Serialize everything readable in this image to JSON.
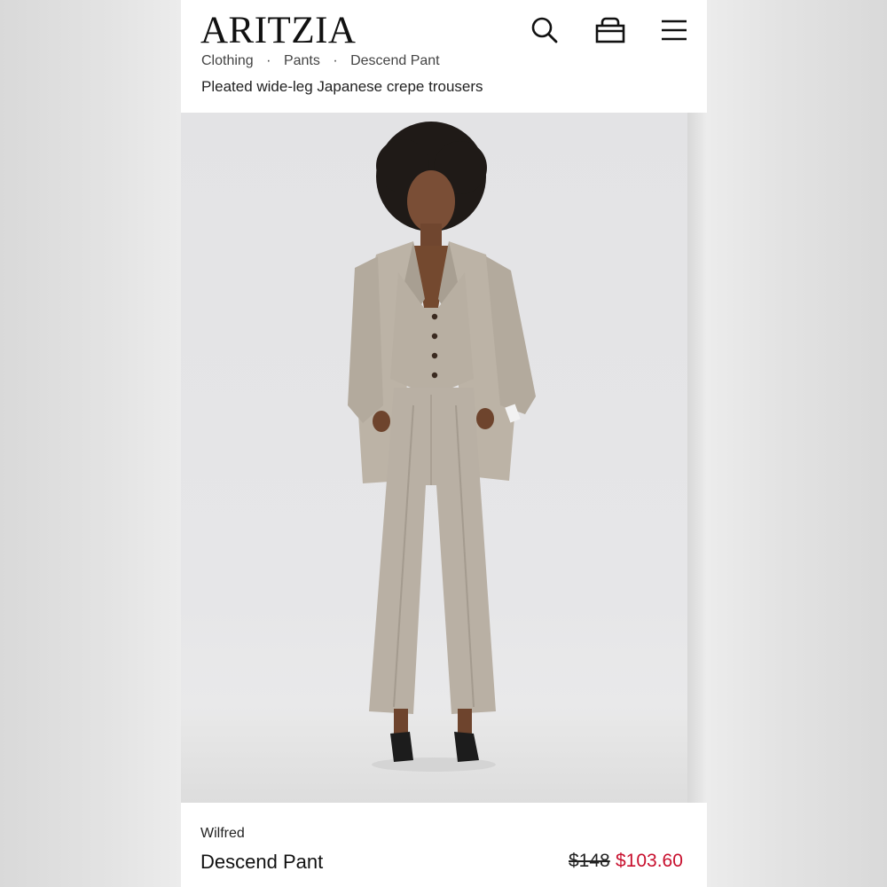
{
  "header": {
    "logo": "ARITZIA",
    "breadcrumb": [
      "Clothing",
      "Pants",
      "Descend Pant"
    ],
    "subtitle": "Pleated wide-leg Japanese crepe trousers"
  },
  "icons": {
    "search": "search-icon",
    "bag": "shopping-bag-icon",
    "menu": "hamburger-menu-icon"
  },
  "product": {
    "brand": "Wilfred",
    "name": "Descend Pant",
    "price_original": "$148",
    "price_sale": "$103.60"
  },
  "colors": {
    "sale": "#c8102e",
    "text": "#111111",
    "suit": "#b9b0a4"
  }
}
